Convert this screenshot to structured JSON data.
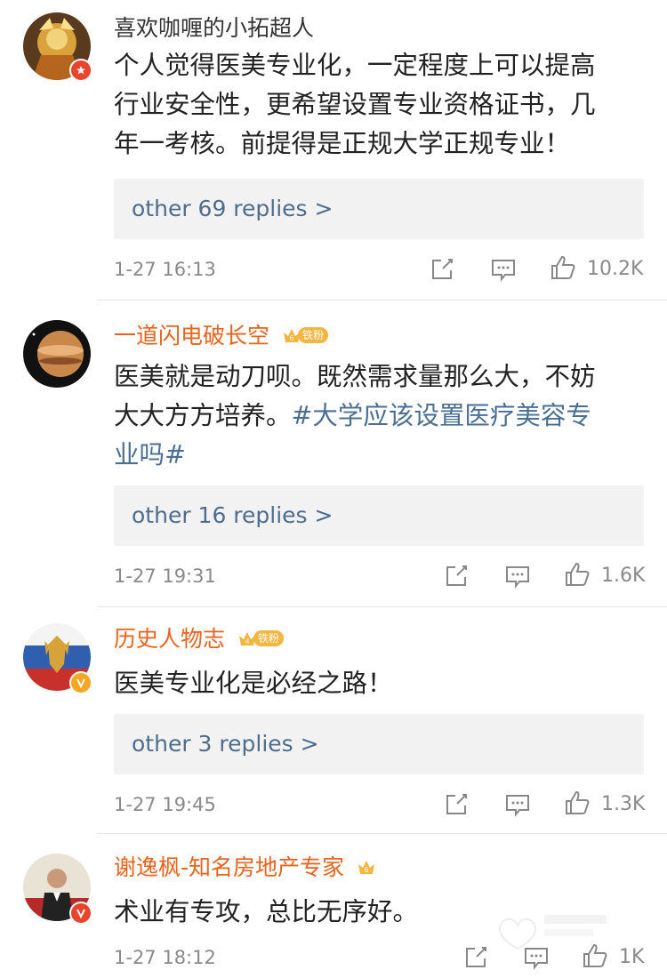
{
  "comments": [
    {
      "username": "喜欢咖喱的小拓超人",
      "text_lines": [
        "个人觉得医美专业化，一定程度上可以提高",
        "行业安全性，更希望设置专业资格证书，几",
        "年一考核。前提得是正规大学正规专业！"
      ],
      "replies_label": "other 69 replies >",
      "time": "1-27 16:13",
      "likes": "10.2K"
    },
    {
      "username": "一道闪电破长空",
      "fan_level": "6",
      "fan_label": "铁粉",
      "text_line1": "医美就是动刀呗。既然需求量那么大，不妨",
      "text_line2_prefix": "大大方方培养。",
      "text_line2_topic": "#大学应该设置医疗美容专",
      "text_line3_topic": "业吗#",
      "replies_label": "other 16 replies >",
      "time": "1-27 19:31",
      "likes": "1.6K"
    },
    {
      "username": "历史人物志",
      "fan_level": "4",
      "fan_label": "铁粉",
      "text": "医美专业化是必经之路！",
      "replies_label": "other 3 replies >",
      "time": "1-27 19:45",
      "likes": "1.3K"
    },
    {
      "username": "谢逸枫-知名房地产专家",
      "fan_level": "6",
      "text": "术业有专攻，总比无序好。",
      "time": "1-27 18:12",
      "likes": "1K"
    }
  ],
  "icons": {
    "share": "share-icon",
    "comment": "comment-icon",
    "like": "thumbs-up-icon"
  },
  "colors": {
    "username_orange": "#e8631c",
    "topic_blue": "#4a6f93",
    "replies_blue": "#4e6d8c",
    "badge_gold": "#f5b63f"
  }
}
